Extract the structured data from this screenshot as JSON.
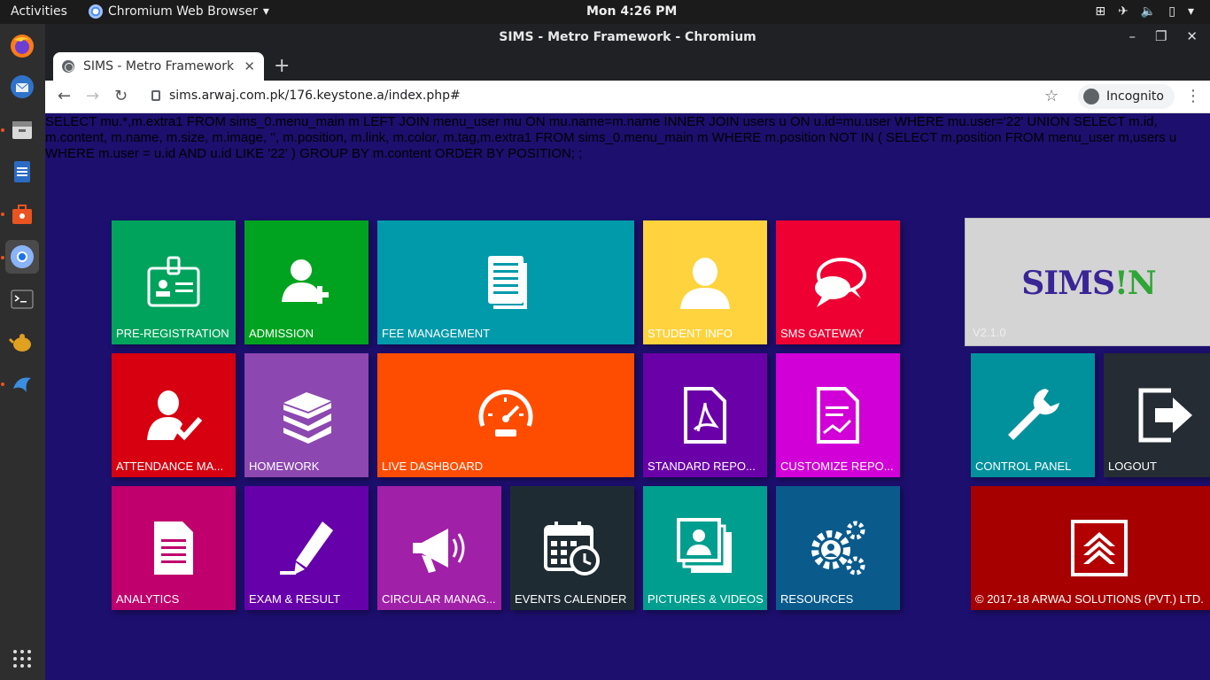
{
  "topbar": {
    "activities": "Activities",
    "app_name": "Chromium Web Browser",
    "clock": "Mon  4:26 PM"
  },
  "window": {
    "title": "SIMS - Metro Framework - Chromium"
  },
  "tab": {
    "title": "SIMS - Metro Framework",
    "close": "✕"
  },
  "toolbar": {
    "url": "sims.arwaj.com.pk/176.keystone.a/index.php#",
    "incognito_label": "Incognito"
  },
  "page": {
    "sql_error": "SELECT mu.*,m.extra1 FROM sims_0.menu_main m LEFT JOIN menu_user mu ON mu.name=m.name INNER JOIN users u ON u.id=mu.user WHERE mu.user='22' UNION SELECT m.id, m.content, m.name, m.size, m.image, '', m.position, m.link, m.color, m.tag,m.extra1 FROM sims_0.menu_main m WHERE m.position NOT IN ( SELECT m.position FROM menu_user m,users u WHERE m.user = u.id AND u.id LIKE '22' ) GROUP BY m.content ORDER BY POSITION; ;",
    "tiles": {
      "pre_registration": "PRE-REGISTRATION",
      "admission": "ADMISSION",
      "fee_management": "FEE MANAGEMENT",
      "student_info": "STUDENT INFO",
      "sms_gateway": "SMS GATEWAY",
      "attendance": "ATTENDANCE MA...",
      "homework": "HOMEWORK",
      "live_dashboard": "LIVE DASHBOARD",
      "standard_reports": "STANDARD REPO...",
      "customize_reports": "CUSTOMIZE REPO...",
      "control_panel": "CONTROL PANEL",
      "logout": "LOGOUT",
      "analytics": "ANALYTICS",
      "exam_result": "EXAM & RESULT",
      "circular": "CIRCULAR MANAG...",
      "events_calendar": "EVENTS CALENDER",
      "pictures_videos": "PICTURES & VIDEOS",
      "resources": "RESOURCES"
    },
    "brand": {
      "logo_text": "SIMS!N",
      "version": "V2.1.0"
    },
    "copyright": "© 2017-18 ARWAJ SOLUTIONS (PVT.) LTD."
  },
  "colors": {
    "background": "#1d0f6e",
    "pre_registration": "#00a35c",
    "admission": "#00a31f",
    "fee_management": "#009aaa",
    "student_info": "#ffd33d",
    "sms_gateway": "#ee0033",
    "attendance": "#d60010",
    "homework": "#8c47b0",
    "live_dashboard": "#ff4d00",
    "standard_reports": "#6a00a8",
    "customize_reports": "#d100d6",
    "control_panel": "#00919d",
    "logout": "#252c33",
    "analytics": "#c0006c",
    "exam_result": "#6600aa",
    "circular": "#a020a8",
    "events_calendar": "#1f2b33",
    "pictures_videos": "#009e8f",
    "resources": "#0a5a8c",
    "copyright": "#a70000"
  }
}
